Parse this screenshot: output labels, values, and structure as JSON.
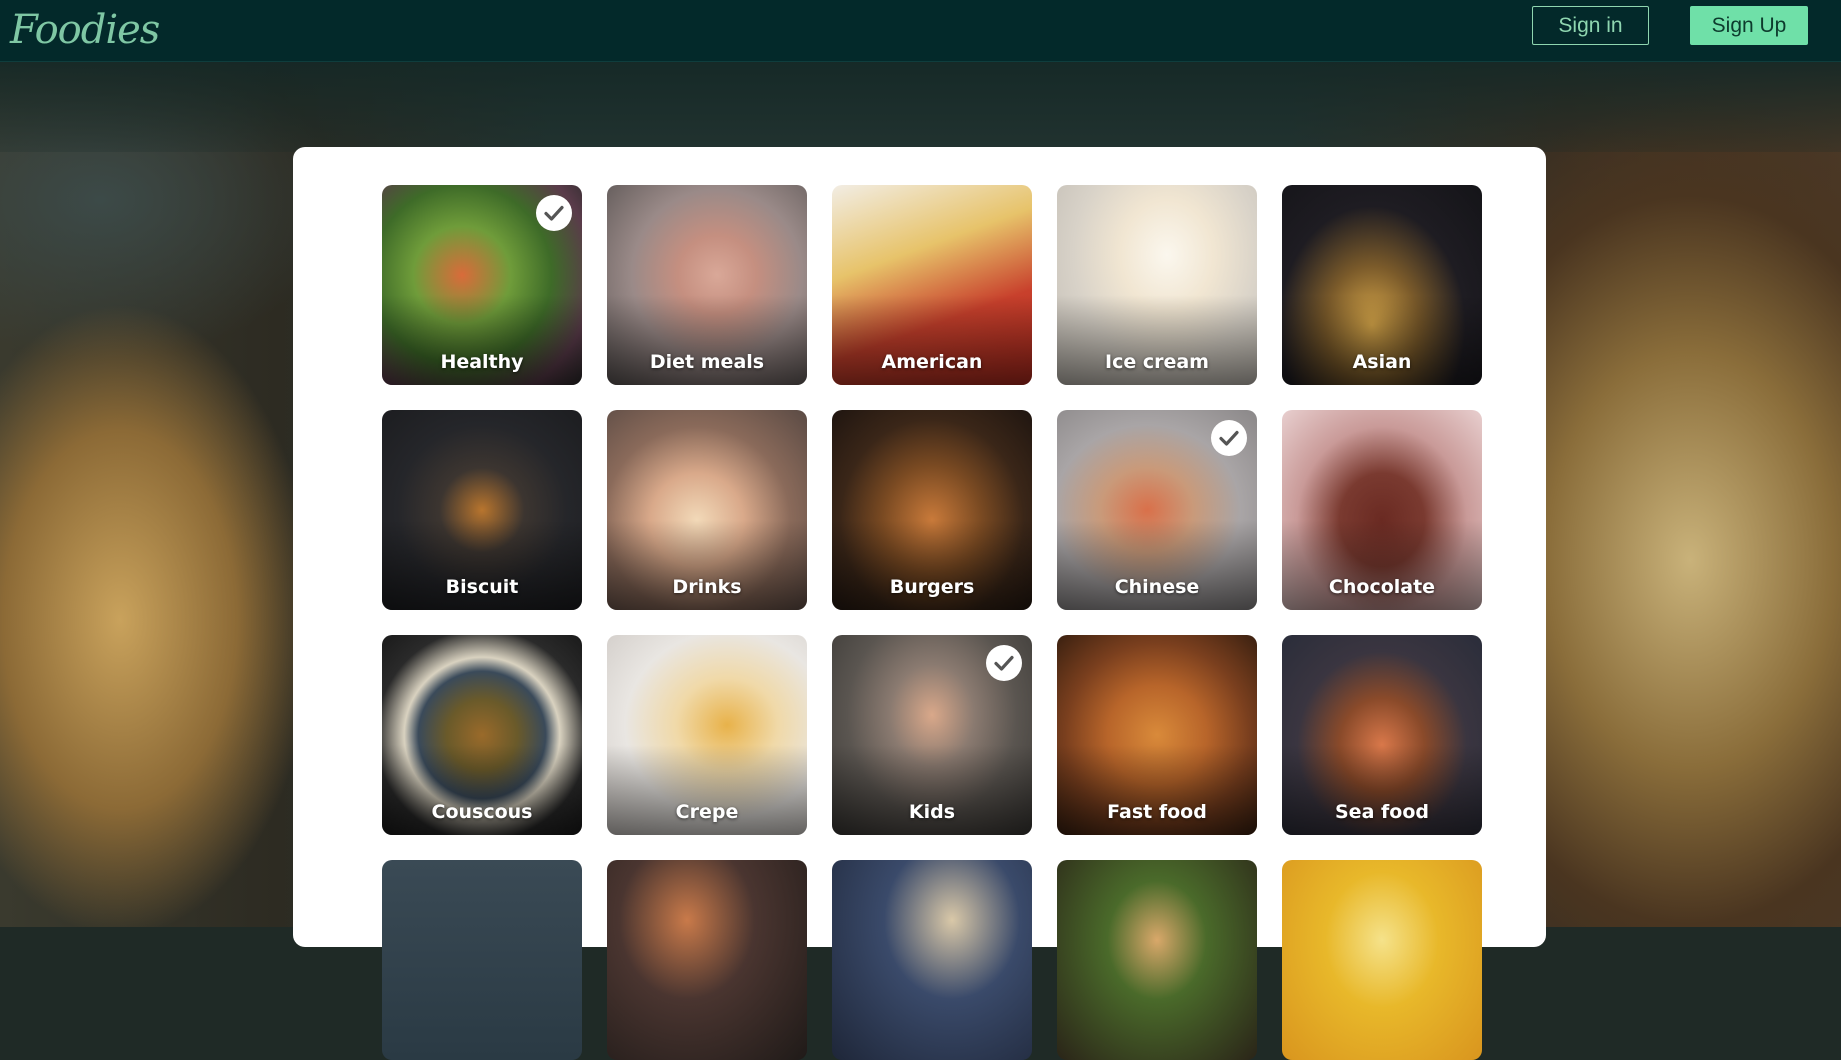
{
  "header": {
    "logo_text": "Foodies",
    "sign_in_label": "Sign in",
    "sign_up_label": "Sign Up"
  },
  "colors": {
    "navbar": "#03292a",
    "accent": "#6fe0a8",
    "panel": "#ffffff"
  },
  "categories": [
    {
      "label": "Healthy",
      "selected": true,
      "icon": "check-icon"
    },
    {
      "label": "Diet meals",
      "selected": false
    },
    {
      "label": "American",
      "selected": false
    },
    {
      "label": "Ice cream",
      "selected": false
    },
    {
      "label": "Asian",
      "selected": false
    },
    {
      "label": "Biscuit",
      "selected": false
    },
    {
      "label": "Drinks",
      "selected": false
    },
    {
      "label": "Burgers",
      "selected": false
    },
    {
      "label": "Chinese",
      "selected": true,
      "icon": "check-icon"
    },
    {
      "label": "Chocolate",
      "selected": false
    },
    {
      "label": "Couscous",
      "selected": false
    },
    {
      "label": "Crepe",
      "selected": false
    },
    {
      "label": "Kids",
      "selected": true,
      "icon": "check-icon"
    },
    {
      "label": "Fast food",
      "selected": false
    },
    {
      "label": "Sea food",
      "selected": false
    },
    {
      "label": "",
      "selected": false
    },
    {
      "label": "",
      "selected": false
    },
    {
      "label": "",
      "selected": false
    },
    {
      "label": "",
      "selected": false
    },
    {
      "label": "",
      "selected": false
    }
  ]
}
